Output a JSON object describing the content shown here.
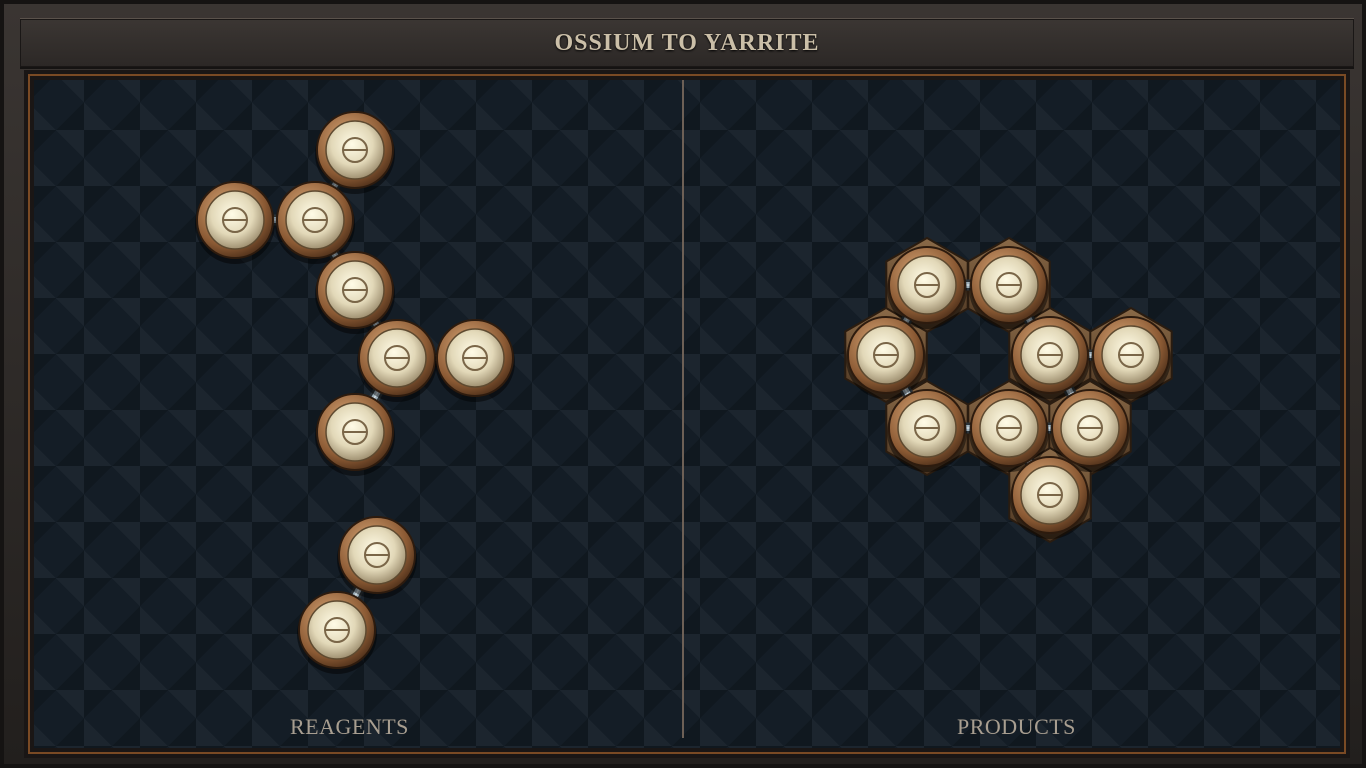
{
  "title": "OSSIUM TO YARRITE",
  "reagents_label": "REAGENTS",
  "products_label": "PRODUCTS",
  "atom_symbol": "θ",
  "atom_icon": "salt-icon",
  "colors": {
    "atom_fill": "#e9e1c6",
    "atom_rim": "#9a6a3e",
    "bond": "#9fb0ba",
    "hex_tile": "#6b4a2e",
    "accent_frame": "#7a4a24"
  }
}
